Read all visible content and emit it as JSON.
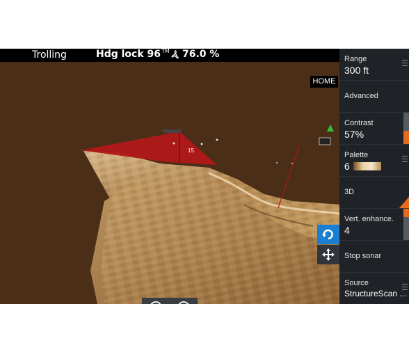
{
  "statusbar": {
    "mode": "Trolling",
    "heading_lock": "Hdg lock 96",
    "trademark": "TM",
    "propulsion_percent": "76.0 %"
  },
  "view": {
    "home_label": "HOME",
    "depth_marker": "15"
  },
  "menu": {
    "range_label": "Range",
    "range_value": "300 ft",
    "advanced_label": "Advanced",
    "contrast_label": "Contrast",
    "contrast_value": "57%",
    "contrast_level": 0.57,
    "palette_label": "Palette",
    "palette_value": "6",
    "mode_3d_label": "3D",
    "vert_enhance_label": "Vert. enhance.",
    "vert_enhance_value": "4",
    "stop_sonar_label": "Stop sonar",
    "source_label": "Source",
    "source_value": "StructureScan ..."
  },
  "colors": {
    "background": "#4a2e18",
    "accent_orange": "#e66a1f",
    "rotate_blue": "#1a7fd0",
    "cone_red": "#b01818"
  },
  "icons": {
    "propeller": "propeller-icon",
    "rotate": "rotate-icon",
    "move": "move-arrows-icon",
    "zoom_out": "zoom-out-icon",
    "zoom_in": "zoom-in-icon",
    "boat": "boat-icon",
    "north": "north-arrow-icon"
  }
}
